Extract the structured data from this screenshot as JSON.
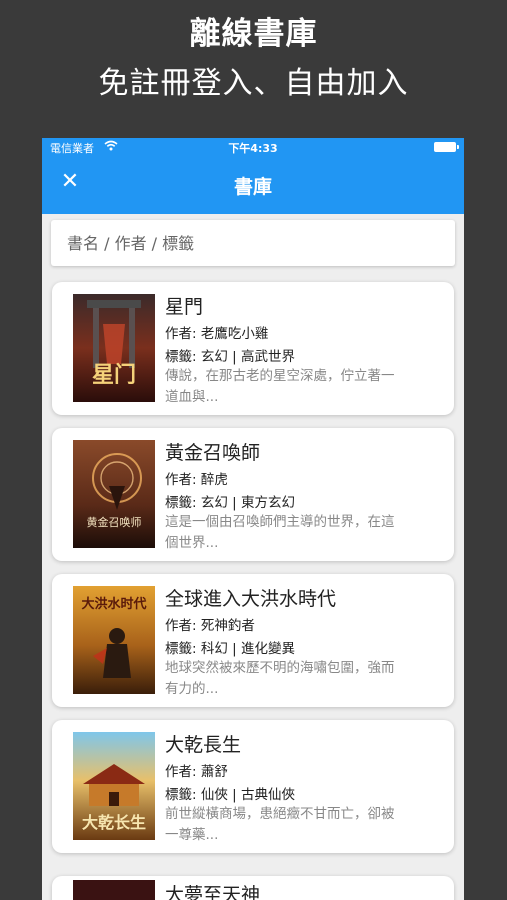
{
  "promo": {
    "title": "離線書庫",
    "subtitle": "免註冊登入、自由加入"
  },
  "status_bar": {
    "carrier": "電信業者",
    "time": "下午4:33"
  },
  "appbar": {
    "title": "書庫",
    "close_icon": "close-icon"
  },
  "search": {
    "placeholder": "書名 / 作者 / 標籤",
    "value": ""
  },
  "books": [
    {
      "title": "星門",
      "author": "作者: 老鷹吃小雞",
      "tags": "標籤: 玄幻 | 高武世界",
      "desc": "傳說，在那古老的星空深處，佇立著一道血與...",
      "cover_text": "星门"
    },
    {
      "title": "黃金召喚師",
      "author": "作者: 醉虎",
      "tags": "標籤: 玄幻 | 東方玄幻",
      "desc": "這是一個由召喚師們主導的世界，在這個世界...",
      "cover_text": "黄金召唤师"
    },
    {
      "title": "全球進入大洪水時代",
      "author": "作者: 死神釣者",
      "tags": "標籤: 科幻 | 進化變異",
      "desc": "地球突然被來歷不明的海嘯包圍，強而有力的...",
      "cover_text": "大洪水时代"
    },
    {
      "title": "大乾長生",
      "author": "作者: 蕭舒",
      "tags": "標籤: 仙俠 | 古典仙俠",
      "desc": "前世縱橫商場，患絕癥不甘而亡，卻被一尊藥...",
      "cover_text": "大乾长生"
    }
  ],
  "partial_book": {
    "title": "大夢至天神"
  },
  "colors": {
    "primary": "#2196f3",
    "background": "#3a3a3a",
    "list_background": "#eeeeee"
  }
}
